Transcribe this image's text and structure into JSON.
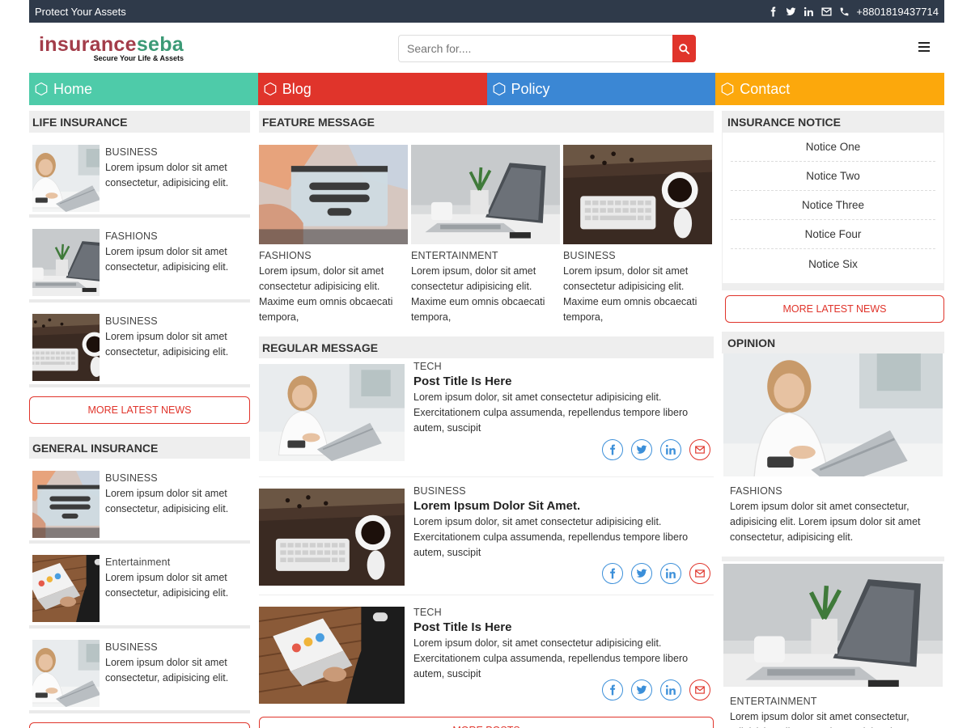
{
  "topbar": {
    "tagline": "Protect Your Assets",
    "phone": "+8801819437714",
    "icons": [
      "facebook-icon",
      "twitter-icon",
      "linkedin-icon",
      "mail-icon",
      "phone-icon"
    ]
  },
  "brand": {
    "logo_part1": "insurance",
    "logo_part2": "seba",
    "tagline": "Secure Your Life & Assets",
    "colors": {
      "part1": "#a33d4a",
      "part2": "#3c9a76"
    }
  },
  "search": {
    "placeholder": "Search for...."
  },
  "nav": [
    {
      "label": "Home",
      "color": "#4ecba9"
    },
    {
      "label": "Blog",
      "color": "#e0342b"
    },
    {
      "label": "Policy",
      "color": "#3b87d4"
    },
    {
      "label": "Contact",
      "color": "#fca80c"
    }
  ],
  "left": {
    "life_heading": "LIFE INSURANCE",
    "life_items": [
      {
        "category": "BUSINESS",
        "text": "Lorem ipsum dolor sit amet consectetur, adipisicing elit.",
        "image": "woman-laptop"
      },
      {
        "category": "FASHIONS",
        "text": "Lorem ipsum dolor sit amet consectetur, adipisicing elit.",
        "image": "laptop-desk"
      },
      {
        "category": "BUSINESS",
        "text": "Lorem ipsum dolor sit amet consectetur, adipisicing elit.",
        "image": "keyboard-coffee"
      }
    ],
    "more_label": "MORE LATEST NEWS",
    "general_heading": "GENERAL INSURANCE",
    "general_items": [
      {
        "category": "BUSINESS",
        "text": "Lorem ipsum dolor sit amet consectetur, adipisicing elit.",
        "image": "login-screen"
      },
      {
        "category": "Entertainment",
        "text": "Lorem ipsum dolor sit amet consectetur, adipisicing elit.",
        "image": "man-laptop"
      },
      {
        "category": "BUSINESS",
        "text": "Lorem ipsum dolor sit amet consectetur, adipisicing elit.",
        "image": "woman-laptop"
      }
    ]
  },
  "middle": {
    "feature_heading": "FEATURE MESSAGE",
    "features": [
      {
        "category": "FASHIONS",
        "text": "Lorem ipsum, dolor sit amet consectetur adipisicing elit. Maxime eum omnis obcaecati tempora,",
        "image": "login-screen"
      },
      {
        "category": "ENTERTAINMENT",
        "text": "Lorem ipsum, dolor sit amet consectetur adipisicing elit. Maxime eum omnis obcaecati tempora,",
        "image": "laptop-desk"
      },
      {
        "category": "BUSINESS",
        "text": "Lorem ipsum, dolor sit amet consectetur adipisicing elit. Maxime eum omnis obcaecati tempora,",
        "image": "keyboard-coffee"
      }
    ],
    "regular_heading": "REGULAR MESSAGE",
    "regular": [
      {
        "category": "TECH",
        "title": "Post Title Is Here",
        "text": "Lorem ipsum dolor, sit amet consectetur adipisicing elit. Exercitationem culpa assumenda, repellendus tempore libero autem, suscipit",
        "image": "woman-laptop"
      },
      {
        "category": "BUSINESS",
        "title": "Lorem Ipsum Dolor Sit Amet.",
        "text": "Lorem ipsum dolor, sit amet consectetur adipisicing elit. Exercitationem culpa assumenda, repellendus tempore libero autem, suscipit",
        "image": "keyboard-coffee"
      },
      {
        "category": "TECH",
        "title": "Post Title Is Here",
        "text": "Lorem ipsum dolor, sit amet consectetur adipisicing elit. Exercitationem culpa assumenda, repellendus tempore libero autem, suscipit",
        "image": "man-laptop"
      }
    ],
    "more_posts_label": "MORE POSTS"
  },
  "right": {
    "notice_heading": "INSURANCE NOTICE",
    "notices": [
      "Notice One",
      "Notice Two",
      "Notice Three",
      "Notice Four",
      "Notice Six"
    ],
    "more_label": "MORE LATEST NEWS",
    "opinion_heading": "OPINION",
    "opinions": [
      {
        "category": "FASHIONS",
        "text": "Lorem ipsum dolor sit amet consectetur, adipisicing elit. Lorem ipsum dolor sit amet consectetur, adipisicing elit.",
        "image": "woman-laptop"
      },
      {
        "category": "ENTERTAINMENT",
        "text": "Lorem ipsum dolor sit amet consectetur, adipisicing elit. Lorem ipsum dolor sit amet consectetur, adipisicing elit.",
        "image": "laptop-desk"
      }
    ]
  }
}
